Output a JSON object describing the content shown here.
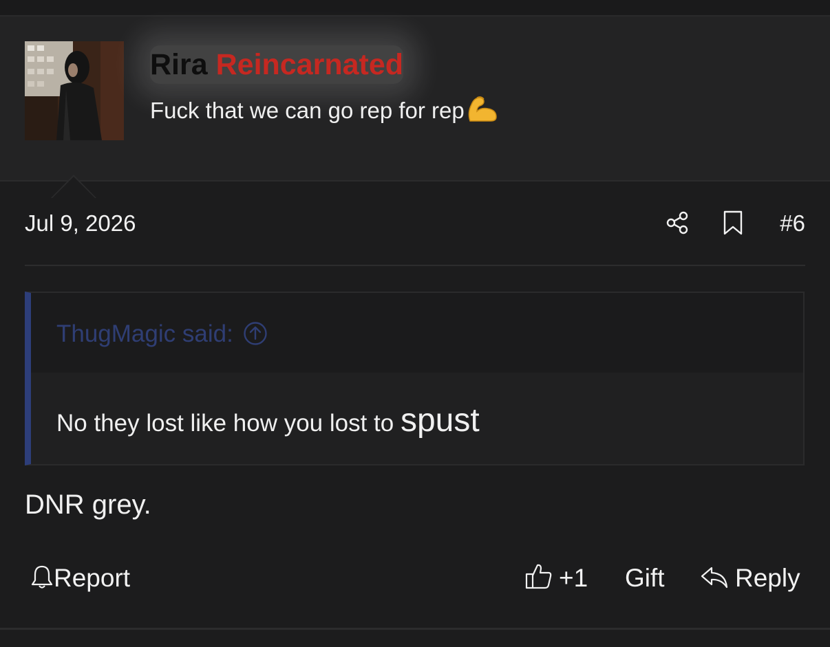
{
  "post": {
    "author": {
      "first_name": "Rira",
      "last_name": "Reincarnated",
      "title": "Fuck that we can go rep for rep",
      "title_emoji": "💪",
      "username_colors": {
        "first": "#0e0e0e",
        "last": "#c62821"
      }
    },
    "date": "Jul 9, 2026",
    "number": "#6",
    "quote": {
      "author_said": "ThugMagic said:",
      "body_start": "No they lost like how you lost to ",
      "body_big": "spust",
      "accent_color": "#2d3e7a"
    },
    "body": "DNR grey.",
    "actions": {
      "report": "Report",
      "like_count": "+1",
      "gift": "Gift",
      "reply": "Reply"
    },
    "icons": [
      "share-icon",
      "bookmark-icon",
      "arrow-up-circle-icon",
      "bell-icon",
      "thumbs-up-icon",
      "reply-arrow-icon"
    ]
  }
}
